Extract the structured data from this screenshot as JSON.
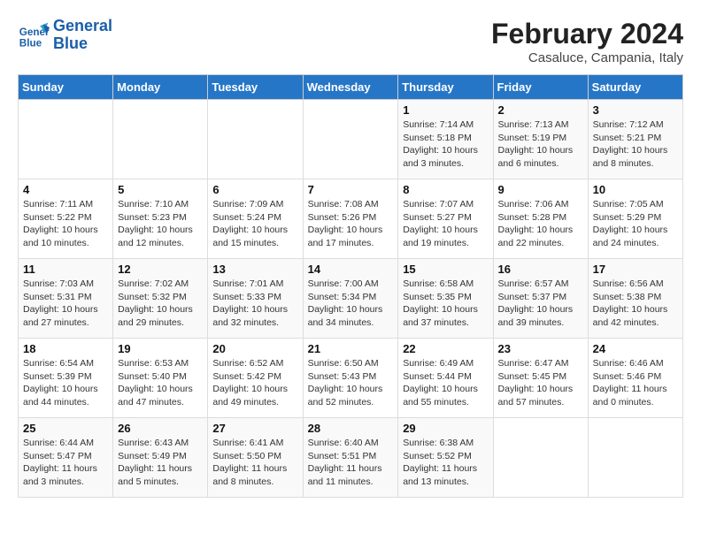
{
  "header": {
    "logo_line1": "General",
    "logo_line2": "Blue",
    "title": "February 2024",
    "subtitle": "Casaluce, Campania, Italy"
  },
  "weekdays": [
    "Sunday",
    "Monday",
    "Tuesday",
    "Wednesday",
    "Thursday",
    "Friday",
    "Saturday"
  ],
  "weeks": [
    [
      {
        "day": "",
        "info": ""
      },
      {
        "day": "",
        "info": ""
      },
      {
        "day": "",
        "info": ""
      },
      {
        "day": "",
        "info": ""
      },
      {
        "day": "1",
        "info": "Sunrise: 7:14 AM\nSunset: 5:18 PM\nDaylight: 10 hours\nand 3 minutes."
      },
      {
        "day": "2",
        "info": "Sunrise: 7:13 AM\nSunset: 5:19 PM\nDaylight: 10 hours\nand 6 minutes."
      },
      {
        "day": "3",
        "info": "Sunrise: 7:12 AM\nSunset: 5:21 PM\nDaylight: 10 hours\nand 8 minutes."
      }
    ],
    [
      {
        "day": "4",
        "info": "Sunrise: 7:11 AM\nSunset: 5:22 PM\nDaylight: 10 hours\nand 10 minutes."
      },
      {
        "day": "5",
        "info": "Sunrise: 7:10 AM\nSunset: 5:23 PM\nDaylight: 10 hours\nand 12 minutes."
      },
      {
        "day": "6",
        "info": "Sunrise: 7:09 AM\nSunset: 5:24 PM\nDaylight: 10 hours\nand 15 minutes."
      },
      {
        "day": "7",
        "info": "Sunrise: 7:08 AM\nSunset: 5:26 PM\nDaylight: 10 hours\nand 17 minutes."
      },
      {
        "day": "8",
        "info": "Sunrise: 7:07 AM\nSunset: 5:27 PM\nDaylight: 10 hours\nand 19 minutes."
      },
      {
        "day": "9",
        "info": "Sunrise: 7:06 AM\nSunset: 5:28 PM\nDaylight: 10 hours\nand 22 minutes."
      },
      {
        "day": "10",
        "info": "Sunrise: 7:05 AM\nSunset: 5:29 PM\nDaylight: 10 hours\nand 24 minutes."
      }
    ],
    [
      {
        "day": "11",
        "info": "Sunrise: 7:03 AM\nSunset: 5:31 PM\nDaylight: 10 hours\nand 27 minutes."
      },
      {
        "day": "12",
        "info": "Sunrise: 7:02 AM\nSunset: 5:32 PM\nDaylight: 10 hours\nand 29 minutes."
      },
      {
        "day": "13",
        "info": "Sunrise: 7:01 AM\nSunset: 5:33 PM\nDaylight: 10 hours\nand 32 minutes."
      },
      {
        "day": "14",
        "info": "Sunrise: 7:00 AM\nSunset: 5:34 PM\nDaylight: 10 hours\nand 34 minutes."
      },
      {
        "day": "15",
        "info": "Sunrise: 6:58 AM\nSunset: 5:35 PM\nDaylight: 10 hours\nand 37 minutes."
      },
      {
        "day": "16",
        "info": "Sunrise: 6:57 AM\nSunset: 5:37 PM\nDaylight: 10 hours\nand 39 minutes."
      },
      {
        "day": "17",
        "info": "Sunrise: 6:56 AM\nSunset: 5:38 PM\nDaylight: 10 hours\nand 42 minutes."
      }
    ],
    [
      {
        "day": "18",
        "info": "Sunrise: 6:54 AM\nSunset: 5:39 PM\nDaylight: 10 hours\nand 44 minutes."
      },
      {
        "day": "19",
        "info": "Sunrise: 6:53 AM\nSunset: 5:40 PM\nDaylight: 10 hours\nand 47 minutes."
      },
      {
        "day": "20",
        "info": "Sunrise: 6:52 AM\nSunset: 5:42 PM\nDaylight: 10 hours\nand 49 minutes."
      },
      {
        "day": "21",
        "info": "Sunrise: 6:50 AM\nSunset: 5:43 PM\nDaylight: 10 hours\nand 52 minutes."
      },
      {
        "day": "22",
        "info": "Sunrise: 6:49 AM\nSunset: 5:44 PM\nDaylight: 10 hours\nand 55 minutes."
      },
      {
        "day": "23",
        "info": "Sunrise: 6:47 AM\nSunset: 5:45 PM\nDaylight: 10 hours\nand 57 minutes."
      },
      {
        "day": "24",
        "info": "Sunrise: 6:46 AM\nSunset: 5:46 PM\nDaylight: 11 hours\nand 0 minutes."
      }
    ],
    [
      {
        "day": "25",
        "info": "Sunrise: 6:44 AM\nSunset: 5:47 PM\nDaylight: 11 hours\nand 3 minutes."
      },
      {
        "day": "26",
        "info": "Sunrise: 6:43 AM\nSunset: 5:49 PM\nDaylight: 11 hours\nand 5 minutes."
      },
      {
        "day": "27",
        "info": "Sunrise: 6:41 AM\nSunset: 5:50 PM\nDaylight: 11 hours\nand 8 minutes."
      },
      {
        "day": "28",
        "info": "Sunrise: 6:40 AM\nSunset: 5:51 PM\nDaylight: 11 hours\nand 11 minutes."
      },
      {
        "day": "29",
        "info": "Sunrise: 6:38 AM\nSunset: 5:52 PM\nDaylight: 11 hours\nand 13 minutes."
      },
      {
        "day": "",
        "info": ""
      },
      {
        "day": "",
        "info": ""
      }
    ]
  ]
}
